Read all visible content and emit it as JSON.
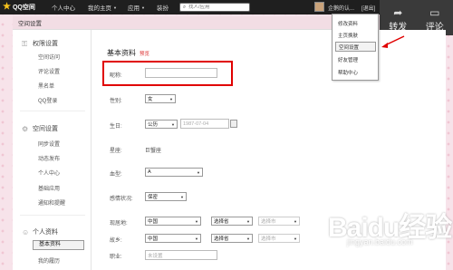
{
  "topbar": {
    "logo": "QQ空间",
    "nav": [
      "个人中心",
      "我的主页",
      "应用",
      "装扮"
    ],
    "search_placeholder": "找人/应用",
    "user_name": "企鹅的认...",
    "logout": "[退出]"
  },
  "share": {
    "forward": "转发",
    "comment": "评论"
  },
  "window_title": "空间设置",
  "sidebar": {
    "groups": [
      {
        "title": "权限设置",
        "items": [
          "空间访问",
          "评论设置",
          "黑名单",
          "QQ登录"
        ]
      },
      {
        "title": "空间设置",
        "items": [
          "同步设置",
          "动态发布",
          "个人中心",
          "基础应用",
          "通知和提醒"
        ]
      },
      {
        "title": "个人资料",
        "items": [
          "基本资料",
          "我的履历"
        ]
      }
    ],
    "active_item": "基本资料"
  },
  "main": {
    "section_title": "基本资料",
    "preview": "预览",
    "nickname_label": "昵称:",
    "nickname_value": "",
    "gender_label": "性别:",
    "gender_value": "女",
    "birthday_label": "生日:",
    "birthday_calendar": "公历",
    "birthday_date": "1987-07-04",
    "constellation_label": "星座:",
    "constellation_value": "巨蟹座",
    "blood_label": "血型:",
    "blood_value": "A",
    "marital_label": "感情状况:",
    "marital_value": "保密",
    "residence_label": "现居地:",
    "residence_country": "中国",
    "residence_province": "选择省",
    "residence_city": "选择市",
    "hometown_label": "故乡:",
    "hometown_country": "中国",
    "hometown_province": "选择省",
    "hometown_city": "选择市",
    "job_label": "职业:",
    "job_placeholder": "未设置"
  },
  "dropdown": [
    "修改资料",
    "主页换肤",
    "空间设置",
    "好友管理",
    "帮助中心"
  ],
  "dropdown_highlighted": "空间设置",
  "watermark": {
    "brand": "Baidu经验",
    "url": "jingyan.baidu.com"
  },
  "colors": {
    "annotation_red": "#e00000",
    "topbar": "#1f1f1f",
    "preview_red": "#dd3333"
  }
}
